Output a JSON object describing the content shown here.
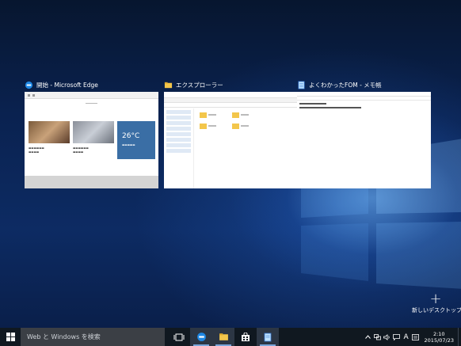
{
  "task_view": {
    "windows": [
      {
        "title": "開始 - Microsoft Edge",
        "icon": "edge-icon"
      },
      {
        "title": "エクスプローラー",
        "icon": "folder-icon"
      },
      {
        "title": "よくわかったFOM - メモ帳",
        "icon": "notepad-icon"
      }
    ],
    "edge_thumb": {
      "weather_temp": "26°C"
    },
    "new_desktop": {
      "plus": "+",
      "label": "新しいデスクトップ"
    }
  },
  "taskbar": {
    "search_placeholder": "Web と Windows を検索",
    "ime_label": "A",
    "clock_time": "2:10",
    "clock_date": "2015/07/23"
  },
  "colors": {
    "taskbar": "#101820",
    "accent": "#7aa6db",
    "folder": "#f3c64b"
  }
}
